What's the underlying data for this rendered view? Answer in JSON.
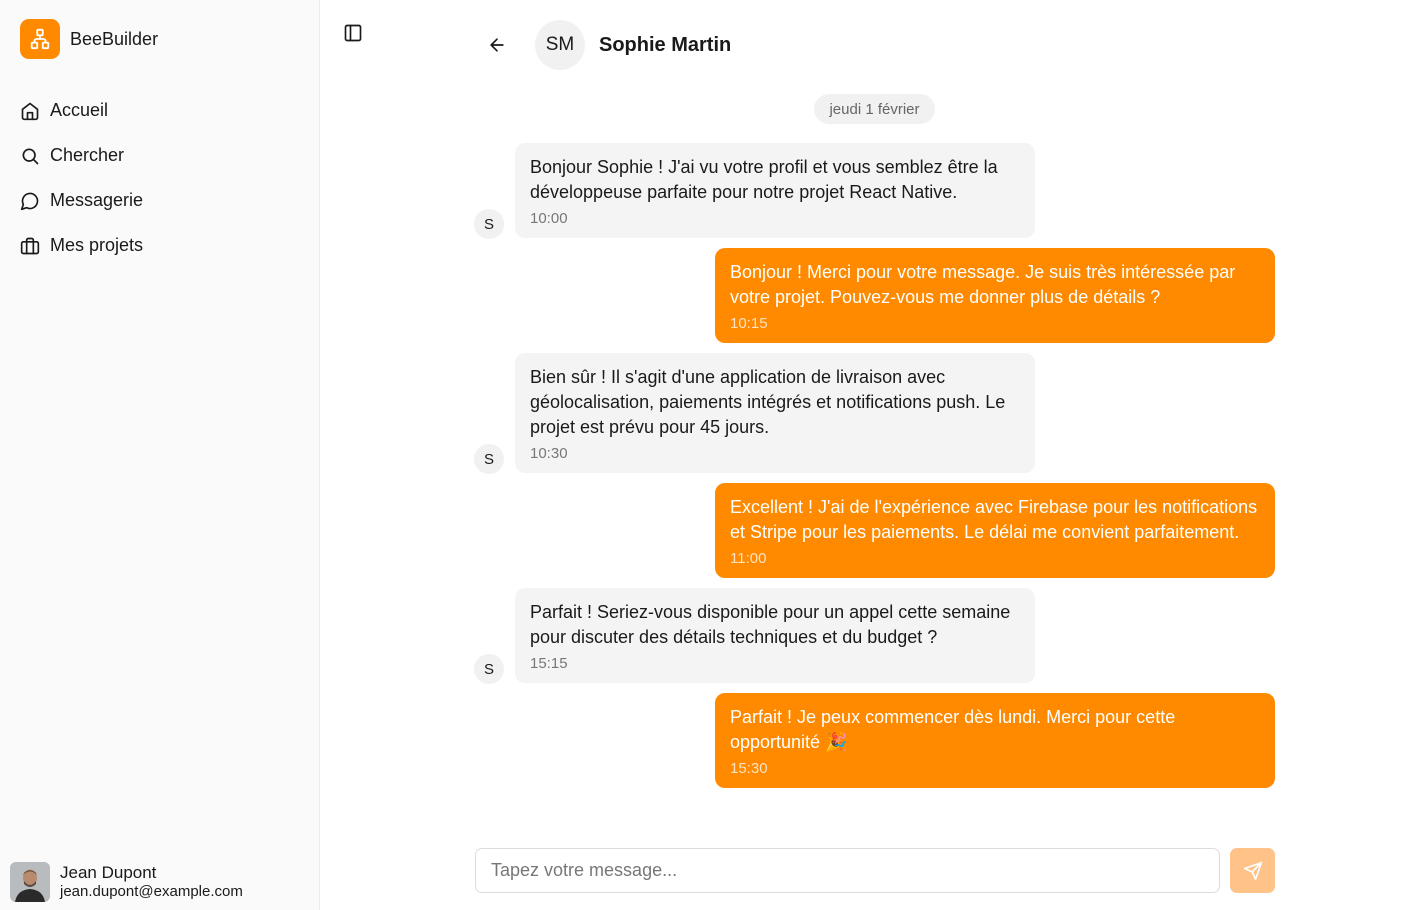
{
  "app": {
    "name": "BeeBuilder",
    "logo_icon": "sitemap-icon",
    "accent": "#ff8a00"
  },
  "sidebar": {
    "items": [
      {
        "label": "Accueil",
        "icon": "home-icon"
      },
      {
        "label": "Chercher",
        "icon": "search-icon"
      },
      {
        "label": "Messagerie",
        "icon": "message-icon"
      },
      {
        "label": "Mes projets",
        "icon": "briefcase-icon"
      }
    ],
    "toggle_icon": "sidebar-toggle-icon"
  },
  "user": {
    "name": "Jean Dupont",
    "email": "jean.dupont@example.com"
  },
  "chat": {
    "contact_initials": "SM",
    "contact_name": "Sophie Martin",
    "date_label": "jeudi 1 février",
    "sender_initial": "S",
    "messages": [
      {
        "direction": "in",
        "text": "Bonjour Sophie ! J'ai vu votre profil et vous semblez être la développeuse parfaite pour notre projet React Native.",
        "time": "10:00"
      },
      {
        "direction": "out",
        "text": "Bonjour ! Merci pour votre message. Je suis très intéressée par votre projet. Pouvez-vous me donner plus de détails ?",
        "time": "10:15"
      },
      {
        "direction": "in",
        "text": "Bien sûr ! Il s'agit d'une application de livraison avec géolocalisation, paiements intégrés et notifications push. Le projet est prévu pour 45 jours.",
        "time": "10:30"
      },
      {
        "direction": "out",
        "text": "Excellent ! J'ai de l'expérience avec Firebase pour les notifications et Stripe pour les paiements. Le délai me convient parfaitement.",
        "time": "11:00"
      },
      {
        "direction": "in",
        "text": "Parfait ! Seriez-vous disponible pour un appel cette semaine pour discuter des détails techniques et du budget ?",
        "time": "15:15"
      },
      {
        "direction": "out",
        "text": "Parfait ! Je peux commencer dès lundi. Merci pour cette opportunité 🎉",
        "time": "15:30"
      }
    ]
  },
  "composer": {
    "placeholder": "Tapez votre message...",
    "send_icon": "send-icon"
  }
}
